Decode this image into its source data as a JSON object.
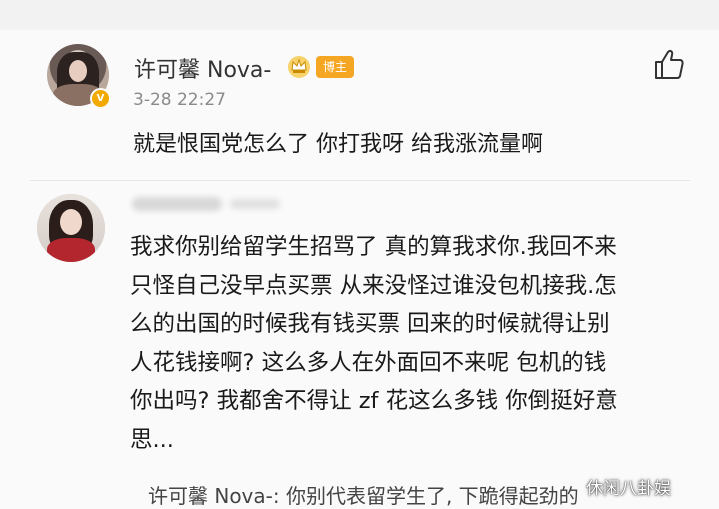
{
  "comment_op": {
    "username": "许可馨 Nova-",
    "badge": "博主",
    "verified_icon": "v-badge-icon",
    "time": "3-28 22:27",
    "text": "就是恨国党怎么了 你打我呀 给我涨流量啊",
    "like_icon": "thumbs-up-icon"
  },
  "comment_reply": {
    "lines": [
      "我求你别给留学生招骂了 真的算我求你.我回不来",
      "只怪自己没早点买票 从来没怪过谁没包机接我.怎",
      "么的出国的时候我有钱买票 回来的时候就得让别",
      "人花钱接啊? 这么多人在外面回不来呢 包机的钱",
      "你出吗? 我都舍不得让 zf 花这么多钱 你倒挺好意",
      "思..."
    ]
  },
  "reply_preview": {
    "text": "许可馨 Nova-: 你别代表留学生了, 下跪得起劲的"
  },
  "watermark": {
    "text": "休闲八卦娱"
  },
  "colors": {
    "badge": "#f5a623",
    "verified": "#f2a900",
    "text": "#1a1a1a",
    "meta": "#8a8a8a"
  }
}
